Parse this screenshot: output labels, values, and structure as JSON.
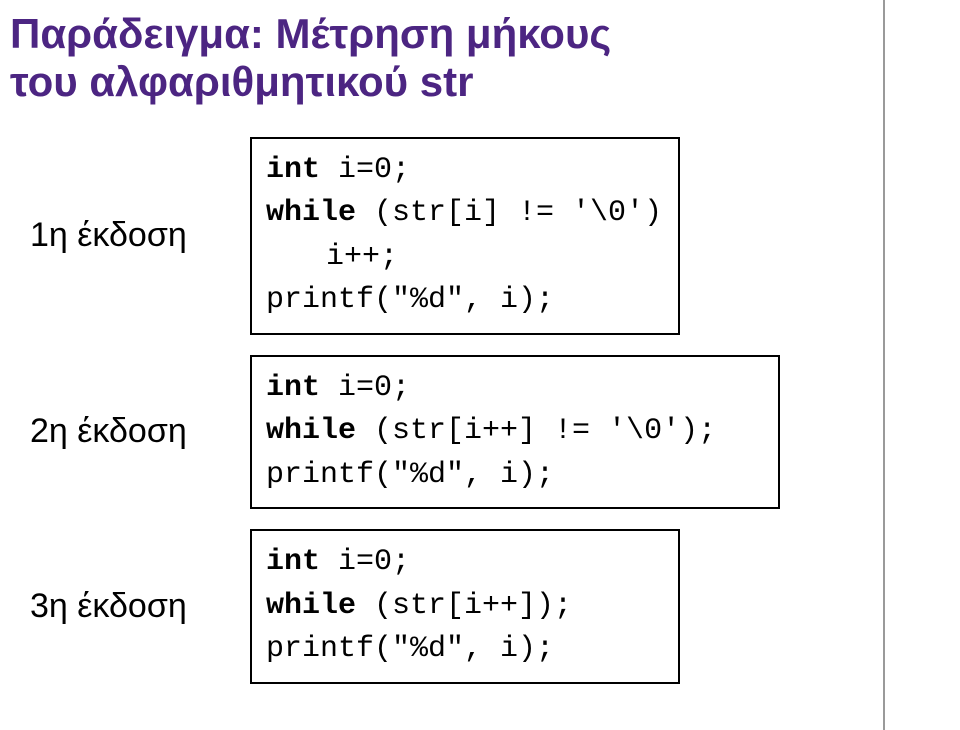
{
  "title": {
    "line1": "Παράδειγμα: Μέτρηση μήκους",
    "line2": "του αλφαριθμητικού str"
  },
  "versions": {
    "v1": {
      "label": "1η έκδοση",
      "code": {
        "l1_kw": "int",
        "l1_rest": " i=0;",
        "l2_kw": "while",
        "l2_rest": " (str[i] != '\\0')",
        "l3": "i++;",
        "l4": "printf(\"%d\", i);"
      }
    },
    "v2": {
      "label": "2η έκδοση",
      "code": {
        "l1_kw": "int",
        "l1_rest": " i=0;",
        "l2_kw": "while",
        "l2_rest": " (str[i++] != '\\0');",
        "l3": "printf(\"%d\", i);"
      }
    },
    "v3": {
      "label": "3η έκδοση",
      "code": {
        "l1_kw": "int",
        "l1_rest": " i=0;",
        "l2_kw": "while",
        "l2_rest": " (str[i++]);",
        "l3": "printf(\"%d\", i);"
      }
    }
  }
}
